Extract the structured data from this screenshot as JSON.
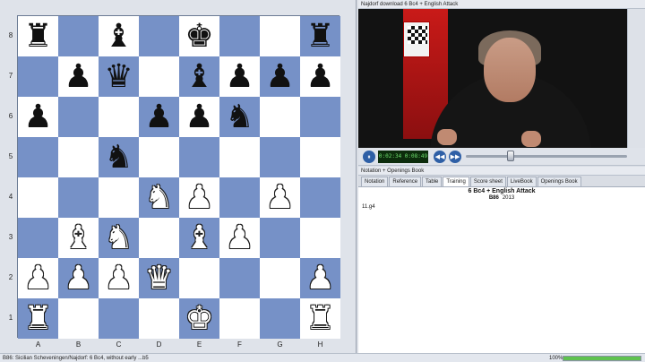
{
  "board": {
    "ranks": [
      "8",
      "7",
      "6",
      "5",
      "4",
      "3",
      "2",
      "1"
    ],
    "files": [
      "A",
      "B",
      "C",
      "D",
      "E",
      "F",
      "G",
      "H"
    ],
    "position": [
      [
        "♜",
        "",
        "♝",
        "",
        "♚",
        "",
        "",
        "♜"
      ],
      [
        "",
        "♟",
        "♛",
        "",
        "♝",
        "♟",
        "♟",
        "♟"
      ],
      [
        "♟",
        "",
        "",
        "♟",
        "♟",
        "♞",
        "",
        ""
      ],
      [
        "",
        "",
        "♞",
        "",
        "",
        "",
        "",
        ""
      ],
      [
        "",
        "",
        "",
        "♘",
        "♙",
        "",
        "♙",
        ""
      ],
      [
        "",
        "♗",
        "♘",
        "",
        "♗",
        "♙",
        "",
        ""
      ],
      [
        "♙",
        "♙",
        "♙",
        "♕",
        "",
        "",
        "",
        "♙"
      ],
      [
        "♖",
        "",
        "",
        "",
        "♔",
        "",
        "",
        "♖"
      ]
    ],
    "colors": {
      "light": "#ffffff",
      "dark": "#7691c7"
    }
  },
  "video": {
    "title": "Najdorf download 6 Bc4 + English Attack",
    "time": "0:02:34 0:08:49",
    "buttons": {
      "pause": "⏸",
      "rewind": "◀◀",
      "forward": "▶▶"
    }
  },
  "notation": {
    "title": "Notation + Openings Book",
    "tabs": [
      "Notation",
      "Reference",
      "Table",
      "Training",
      "Score sheet",
      "LiveBook",
      "Openings Book"
    ],
    "active_tab": "Training",
    "game_title": "6 Bc4 + English Attack",
    "eco": "B86",
    "year": "2013",
    "moves": "11.g4"
  },
  "status": {
    "text": "B86: Sicilian Scheveningen/Najdorf: 6 Bc4, without early ...b5",
    "zoom": "100%"
  }
}
